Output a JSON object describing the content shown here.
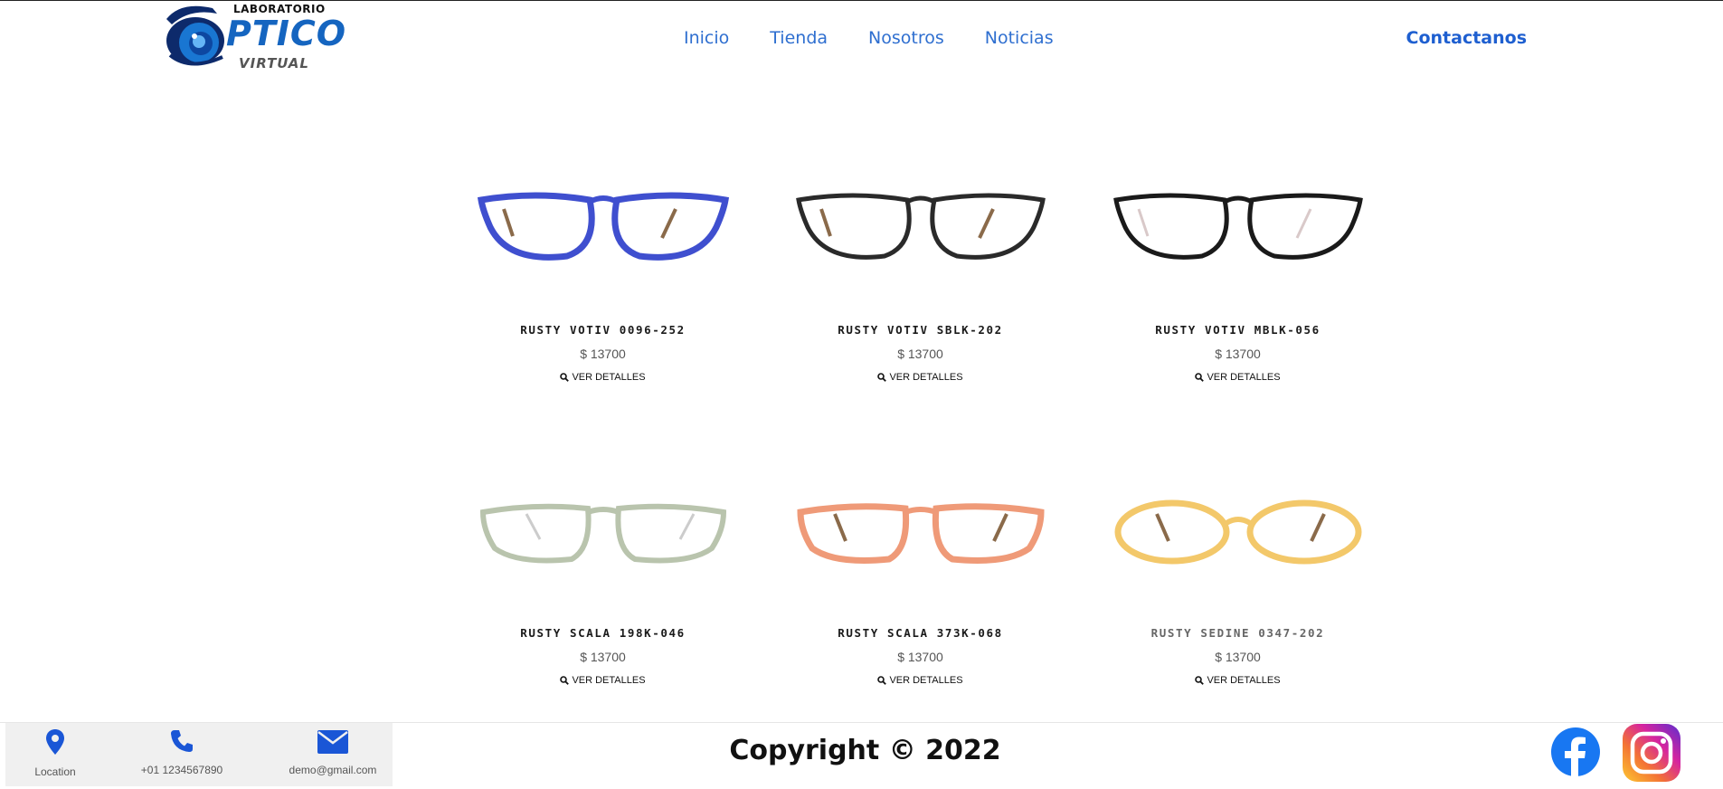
{
  "logo": {
    "top_text": "LABORATORIO",
    "main_text": "PTICO",
    "sub_text": "VIRTUAL"
  },
  "nav": {
    "items": [
      {
        "label": "Inicio"
      },
      {
        "label": "Tienda"
      },
      {
        "label": "Nosotros"
      },
      {
        "label": "Noticias"
      }
    ],
    "contact_label": "Contactanos"
  },
  "products": [
    {
      "name": "RUSTY VOTIV 0096-252",
      "price": "$ 13700",
      "details_label": "VER DETALLES",
      "frame_color": "#3f4fcf"
    },
    {
      "name": "RUSTY VOTIV SBLK-202",
      "price": "$ 13700",
      "details_label": "VER DETALLES",
      "frame_color": "#2a2a2a"
    },
    {
      "name": "RUSTY VOTIV MBLK-056",
      "price": "$ 13700",
      "details_label": "VER DETALLES",
      "frame_color": "#1a1a1a"
    },
    {
      "name": "RUSTY SCALA 198K-046",
      "price": "$ 13700",
      "details_label": "VER DETALLES",
      "frame_color": "#b9c4ad"
    },
    {
      "name": "RUSTY SCALA 373K-068",
      "price": "$ 13700",
      "details_label": "VER DETALLES",
      "frame_color": "#ef9a78"
    },
    {
      "name": "RUSTY SEDINE 0347-202",
      "price": "$ 13700",
      "details_label": "VER DETALLES",
      "frame_color": "#f3c86a"
    }
  ],
  "footer": {
    "location_label": "Location",
    "phone_label": "+01 1234567890",
    "email_label": "demo@gmail.com",
    "copyright": "Copyright © 2022"
  },
  "colors": {
    "accent": "#1e5fd0",
    "nav": "#2f6fd0",
    "icon_blue": "#1a56d6"
  }
}
